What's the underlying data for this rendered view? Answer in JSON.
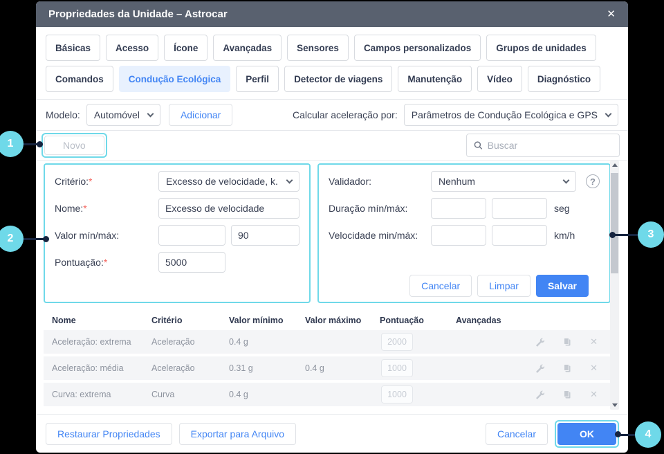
{
  "colors": {
    "accent": "#4285f4",
    "highlight": "#6fd9e9",
    "titlebar": "#59616f",
    "row_bg": "#f4f5f7"
  },
  "titlebar": {
    "title": "Propriedades da Unidade – Astrocar"
  },
  "tabs": {
    "row1": [
      "Básicas",
      "Acesso",
      "Ícone",
      "Avançadas",
      "Sensores",
      "Campos personalizados",
      "Grupos de unidades"
    ],
    "row2": [
      "Comandos",
      "Condução Ecológica",
      "Perfil",
      "Detector de viagens",
      "Manutenção",
      "Vídeo",
      "Diagnóstico"
    ],
    "active_tab": "Condução Ecológica"
  },
  "model_bar": {
    "model_label": "Modelo:",
    "model_value": "Automóvel",
    "add_button": "Adicionar",
    "calc_label": "Calcular aceleração por:",
    "calc_value": "Parâmetros de Condução Ecológica e GPS"
  },
  "toolbar": {
    "new_button": "Novo",
    "search_placeholder": "Buscar"
  },
  "editor": {
    "required_mark": "*",
    "left": {
      "criterion_label": "Critério:",
      "criterion_value": "Excesso de velocidade, k...",
      "name_label": "Nome:",
      "name_value": "Excesso de velocidade",
      "minmax_label": "Valor mín/máx:",
      "min_value": "",
      "max_value": "90",
      "score_label": "Pontuação:",
      "score_value": "5000"
    },
    "right": {
      "validator_label": "Validador:",
      "validator_value": "Nenhum",
      "help": "?",
      "duration_label": "Duração mín/máx:",
      "duration_unit": "seg",
      "speed_label": "Velocidade min/máx:",
      "speed_unit": "km/h",
      "cancel_button": "Cancelar",
      "clear_button": "Limpar",
      "save_button": "Salvar"
    }
  },
  "table": {
    "headers": [
      "Nome",
      "Critério",
      "Valor mínimo",
      "Valor máximo",
      "Pontuação",
      "Avançadas"
    ],
    "rows": [
      {
        "name": "Aceleração: extrema",
        "criterion": "Aceleração",
        "min": "0.4 g",
        "max": "",
        "score": "2000"
      },
      {
        "name": "Aceleração: média",
        "criterion": "Aceleração",
        "min": "0.31 g",
        "max": "0.4 g",
        "score": "1000"
      },
      {
        "name": "Curva: extrema",
        "criterion": "Curva",
        "min": "0.4 g",
        "max": "",
        "score": "1000"
      }
    ]
  },
  "footer": {
    "restore_button": "Restaurar Propriedades",
    "export_button": "Exportar para Arquivo",
    "cancel_button": "Cancelar",
    "ok_button": "OK"
  },
  "callouts": {
    "c1": "1",
    "c2": "2",
    "c3": "3",
    "c4": "4"
  }
}
